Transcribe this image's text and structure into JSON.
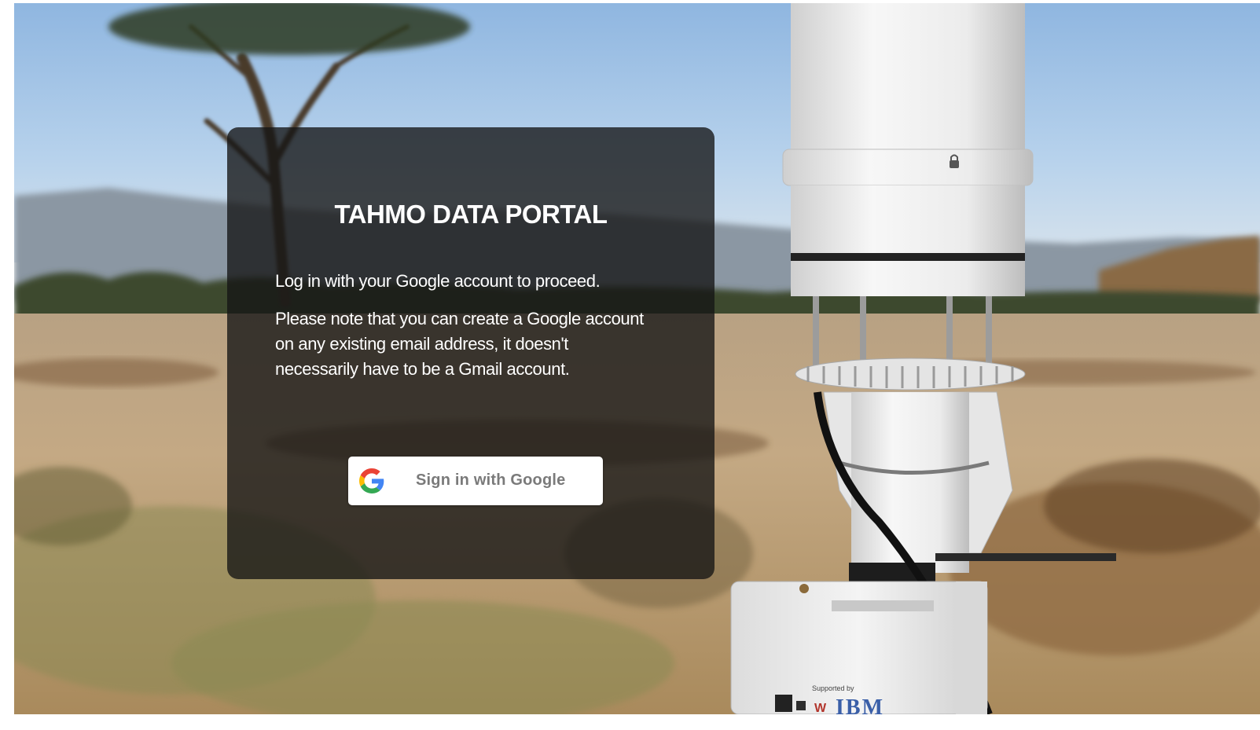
{
  "login": {
    "title": "TAHMO DATA PORTAL",
    "intro": "Log in with your Google account to proceed.",
    "note": "Please note that you can create a Google account on any existing email address, it doesn't necessarily have to be a Gmail account.",
    "google_button_label": "Sign in with Google",
    "google_button_icon": "google-g-icon"
  },
  "background": {
    "sponsor_label": "Supported by",
    "sponsor_logo_text": "IBM"
  },
  "colors": {
    "card_overlay": "#141414",
    "title_text": "#ffffff",
    "button_background": "#ffffff",
    "button_text": "#7a7a7a",
    "google_blue": "#4285F4",
    "google_red": "#EA4335",
    "google_yellow": "#FBBC05",
    "google_green": "#34A853"
  }
}
